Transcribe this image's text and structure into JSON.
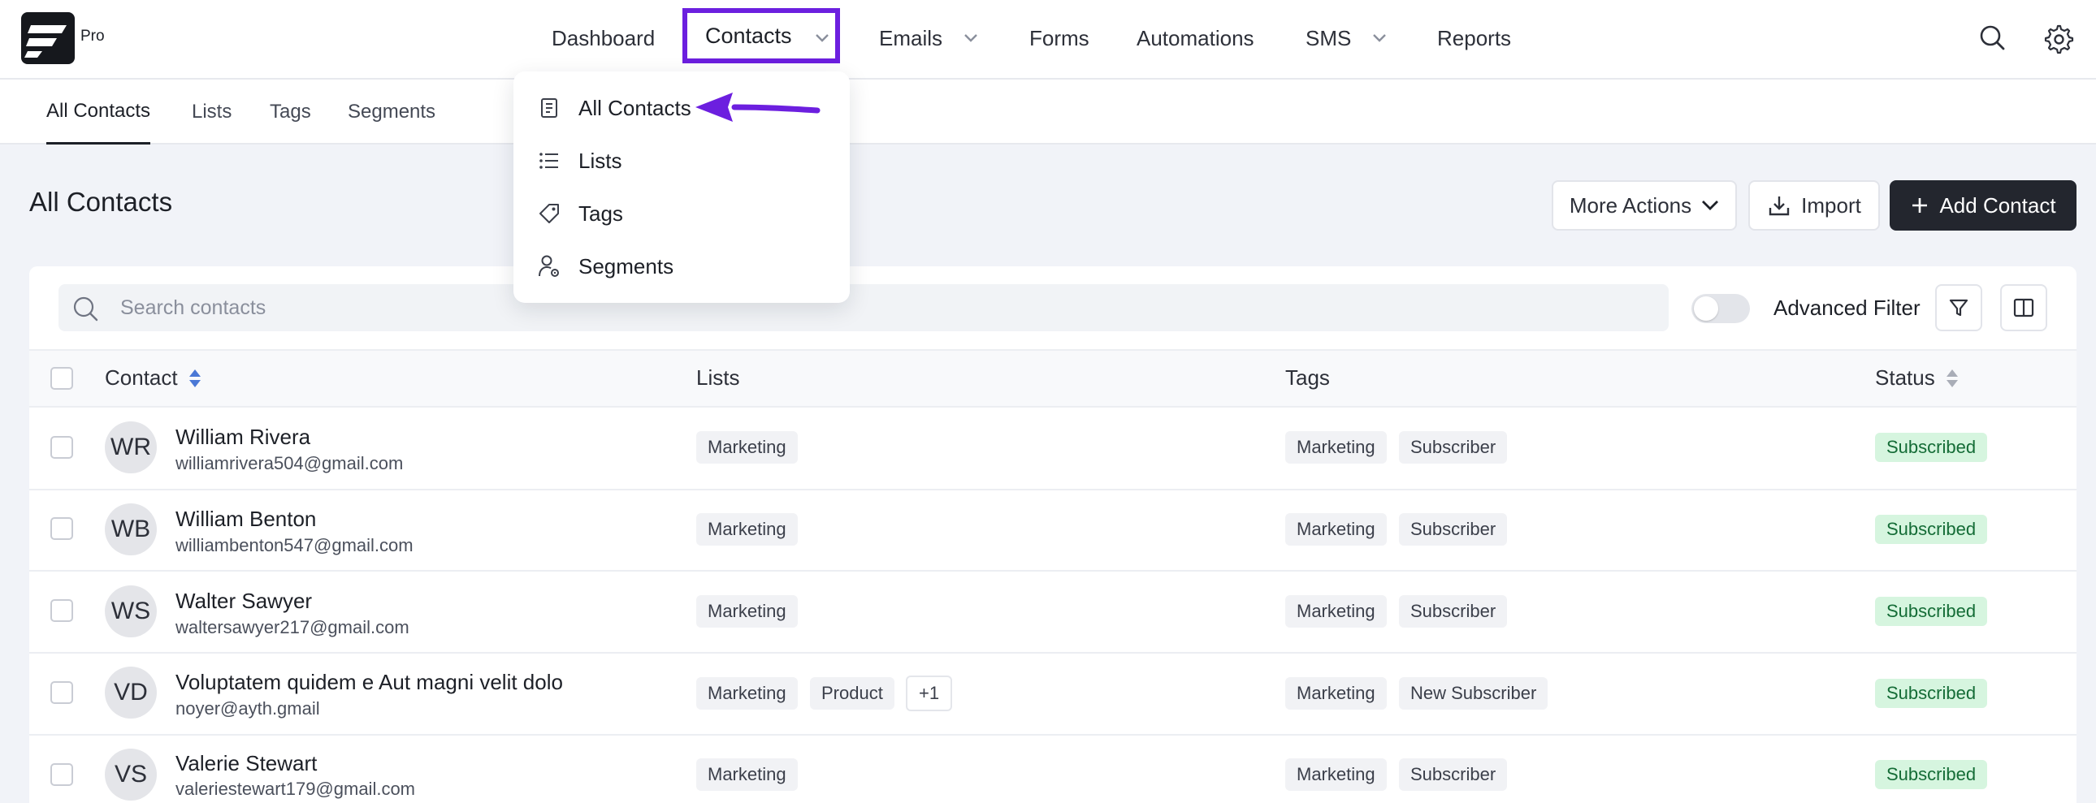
{
  "app": {
    "logo_badge": "Pro"
  },
  "nav": {
    "items": [
      {
        "label": "Dashboard",
        "has_chevron": false
      },
      {
        "label": "Contacts",
        "has_chevron": true
      },
      {
        "label": "Emails",
        "has_chevron": true
      },
      {
        "label": "Forms",
        "has_chevron": false
      },
      {
        "label": "Automations",
        "has_chevron": false
      },
      {
        "label": "SMS",
        "has_chevron": true
      },
      {
        "label": "Reports",
        "has_chevron": false
      }
    ],
    "right_icons": [
      "search-icon",
      "gear-icon"
    ]
  },
  "subnav": {
    "items": [
      "All Contacts",
      "Lists",
      "Tags",
      "Segments"
    ],
    "active": "All Contacts"
  },
  "dropdown": {
    "items": [
      {
        "label": "All Contacts",
        "icon": "contacts-list-icon"
      },
      {
        "label": "Lists",
        "icon": "list-icon"
      },
      {
        "label": "Tags",
        "icon": "tag-icon"
      },
      {
        "label": "Segments",
        "icon": "user-gear-icon"
      }
    ]
  },
  "page": {
    "title": "All Contacts",
    "more_actions_label": "More Actions",
    "import_label": "Import",
    "add_contact_label": "Add Contact"
  },
  "filters": {
    "search_placeholder": "Search contacts",
    "advanced_filter_label": "Advanced Filter",
    "advanced_filter_on": false
  },
  "table": {
    "columns": [
      "Contact",
      "Lists",
      "Tags",
      "Status"
    ],
    "rows": [
      {
        "initials": "WR",
        "name": "William Rivera",
        "email": "williamrivera504@gmail.com",
        "lists": [
          "Marketing"
        ],
        "tags": [
          "Marketing",
          "Subscriber"
        ],
        "status": "Subscribed"
      },
      {
        "initials": "WB",
        "name": "William Benton",
        "email": "williambenton547@gmail.com",
        "lists": [
          "Marketing"
        ],
        "tags": [
          "Marketing",
          "Subscriber"
        ],
        "status": "Subscribed"
      },
      {
        "initials": "WS",
        "name": "Walter Sawyer",
        "email": "waltersawyer217@gmail.com",
        "lists": [
          "Marketing"
        ],
        "tags": [
          "Marketing",
          "Subscriber"
        ],
        "status": "Subscribed"
      },
      {
        "initials": "VD",
        "name": "Voluptatem quidem e Aut magni velit dolo",
        "email": "noyer@ayth.gmail",
        "lists": [
          "Marketing",
          "Product",
          "+1"
        ],
        "tags": [
          "Marketing",
          "New Subscriber"
        ],
        "status": "Subscribed"
      },
      {
        "initials": "VS",
        "name": "Valerie Stewart",
        "email": "valeriestewart179@gmail.com",
        "lists": [
          "Marketing"
        ],
        "tags": [
          "Marketing",
          "Subscriber"
        ],
        "status": "Subscribed"
      }
    ]
  },
  "colors": {
    "highlight": "#6c1fdf",
    "status_bg": "#d6f5df",
    "status_text": "#146c36",
    "primary_btn": "#23262e"
  }
}
